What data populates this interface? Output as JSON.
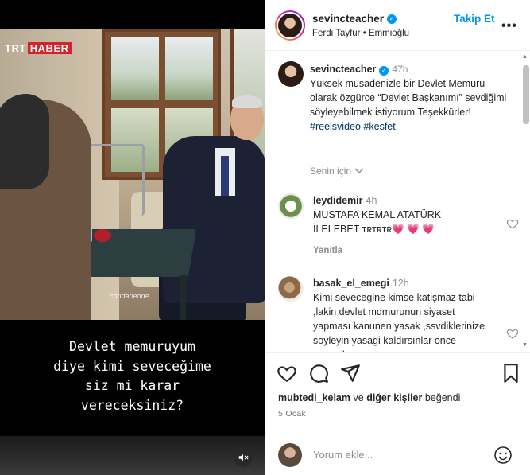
{
  "video": {
    "channel_logo_left": "TRT",
    "channel_logo_right": "HABER",
    "watermark": "condarleone",
    "subtitle": "Devlet memuruyum\ndiye kimi seveceğime\nsiz mi karar\nvereceksiniz?",
    "mute_icon": "speaker-muted-icon"
  },
  "header": {
    "username": "sevincteacher",
    "subtitle": "Ferdi Tayfur • Emmioğlu",
    "follow_label": "Takip Et",
    "more_label": "•••"
  },
  "caption": {
    "username": "sevincteacher",
    "time": "47h",
    "text": "Yüksek müsadenizle bir Devlet Memuru olarak özgürce “Devlet Başkanımı” sevdiğimi söyleyebilmek istiyorum.Teşekkürler!",
    "hashtags": [
      "#reelsvideo",
      "#kesfet"
    ],
    "see_translation": "Senin için"
  },
  "comments": [
    {
      "username": "leydidemir",
      "time": "4h",
      "text": "MUSTAFA KEMAL ATATÜRK İLELEBET ᴛʀᴛʀᴛʀ💗 💗 💗",
      "reply_label": "Yanıtla"
    },
    {
      "username": "basak_el_emegi",
      "time": "12h",
      "text": "Kimi sevecegine kimse katişmaz tabi ,lakin devlet mdmurunun siyaset yapması kanunen yasak ,ssvdiklerinize soyleyin yasagi kaldırsınlar once yapsınlar"
    }
  ],
  "likes": {
    "user": "mubtedi_kelam",
    "connector": "ve",
    "others": "diğer kişiler",
    "suffix": "beğendi"
  },
  "date": "5 Ocak",
  "composer": {
    "placeholder": "Yorum ekle..."
  },
  "colors": {
    "accent": "#0095f6",
    "hashtag": "#00376b",
    "muted": "#8e8e8e",
    "heart": "#ed4956",
    "trt_red": "#d4222d"
  }
}
